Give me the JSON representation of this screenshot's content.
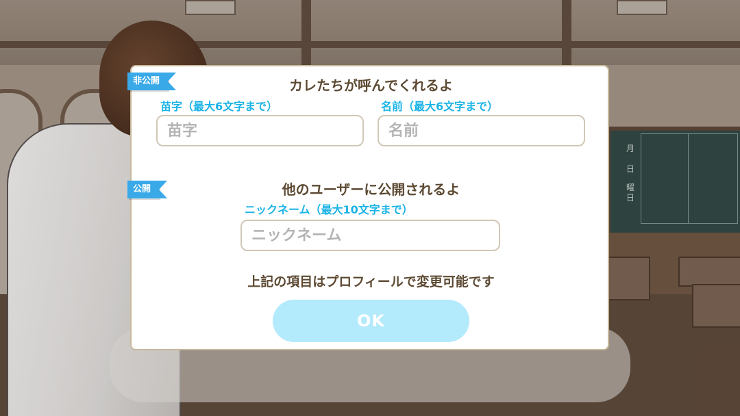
{
  "dialog": {
    "private_tag": "非公開",
    "private_heading": "カレたちが呼んでくれるよ",
    "surname_label": "苗字（最大6文字まで）",
    "surname_placeholder": "苗字",
    "surname_value": "",
    "given_label": "名前（最大6文字まで）",
    "given_placeholder": "名前",
    "given_value": "",
    "public_tag": "公開",
    "public_heading": "他のユーザーに公開されるよ",
    "nickname_label": "ニックネーム（最大10文字まで）",
    "nickname_placeholder": "ニックネーム",
    "nickname_value": "",
    "note": "上記の項目はプロフィールで変更可能です",
    "ok_label": "OK"
  },
  "background": {
    "blackboard_chars": [
      "月",
      "日",
      "曜",
      "日"
    ]
  },
  "colors": {
    "tag_blue": "#3aa9e8",
    "label_cyan": "#1ab3e6",
    "heading_brown": "#5d4a33",
    "ok_button": "#b3eafc",
    "dialog_border": "#c8b89b"
  }
}
